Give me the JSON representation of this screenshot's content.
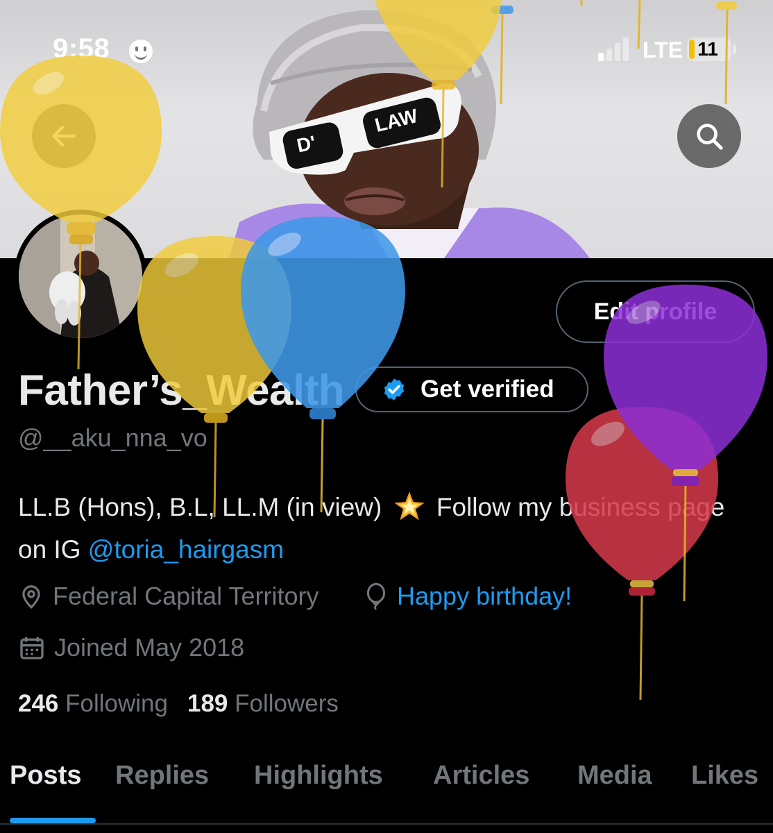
{
  "status_bar": {
    "time": "9:58",
    "network": "LTE",
    "battery": "11"
  },
  "header": {
    "back_icon": "arrow-left-icon",
    "search_icon": "search-icon",
    "banner_glasses_left": "D'",
    "banner_glasses_right": "LAW"
  },
  "profile": {
    "display_name": "Father’s_Wealth",
    "handle": "@__aku_nna_vo",
    "edit_label": "Edit profile",
    "verify_label": "Get verified",
    "bio_text": "LL.B (Hons), B.L, LL.M (in view) ",
    "bio_text2": " Follow my business page on IG ",
    "bio_mention": "@toria_hairgasm",
    "location": "Federal Capital Territory",
    "birthday": "Happy birthday!",
    "joined": "Joined May 2018",
    "following_count": "246",
    "following_label": "Following",
    "followers_count": "189",
    "followers_label": "Followers"
  },
  "tabs": [
    {
      "label": "Posts",
      "active": true
    },
    {
      "label": "Replies",
      "active": false
    },
    {
      "label": "Highlights",
      "active": false
    },
    {
      "label": "Articles",
      "active": false
    },
    {
      "label": "Media",
      "active": false
    },
    {
      "label": "Likes",
      "active": false
    }
  ],
  "colors": {
    "accent": "#1d9bf0",
    "background": "#000000",
    "secondary_text": "#71767b",
    "balloon_yellow": "#f2cc3a",
    "balloon_blue": "#3f98e8",
    "balloon_purple": "#8d2fd6",
    "balloon_red": "#d83a4c"
  }
}
